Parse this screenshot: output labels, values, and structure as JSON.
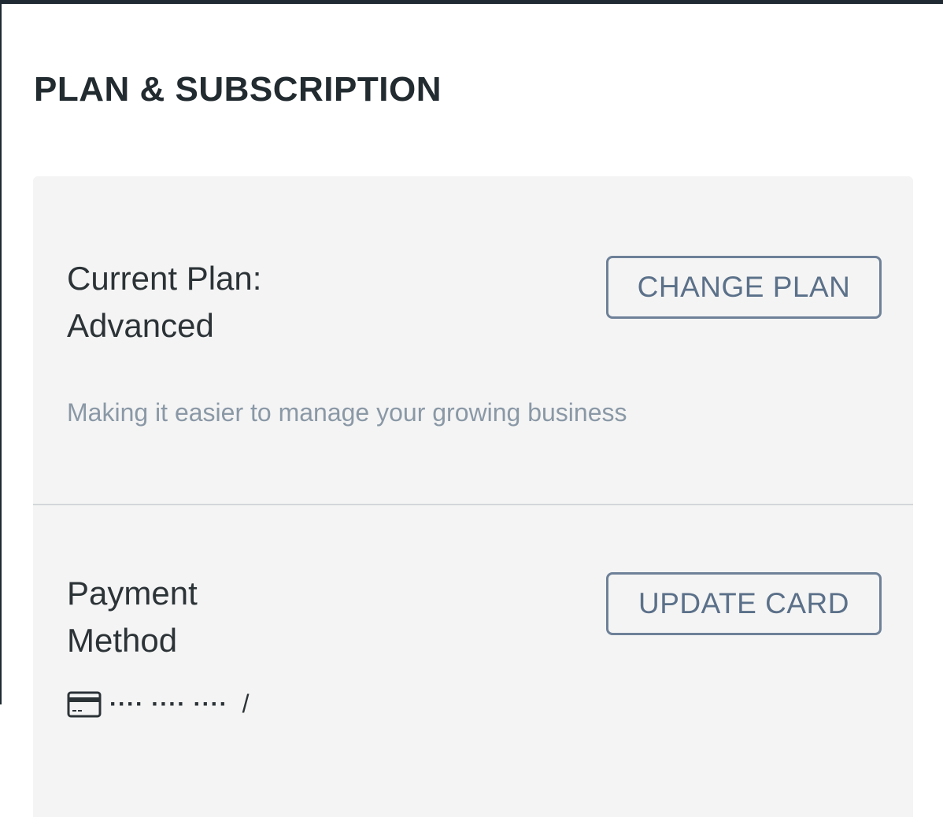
{
  "page": {
    "title": "PLAN & SUBSCRIPTION"
  },
  "plan": {
    "label_line1": "Current Plan:",
    "label_line2": "Advanced",
    "description": "Making it easier to manage your growing business",
    "button_label": "CHANGE PLAN"
  },
  "payment": {
    "label_line1": "Payment",
    "label_line2": "Method",
    "card_icon": "credit-card-icon",
    "card_number_masked": "···· ···· ····",
    "card_expiry": "/",
    "button_label": "UPDATE CARD"
  },
  "colors": {
    "card_background": "#f4f4f4",
    "button_border": "#6e8198",
    "button_text": "#5b7089",
    "description_text": "#8a98a6",
    "primary_text": "#2c3337"
  }
}
